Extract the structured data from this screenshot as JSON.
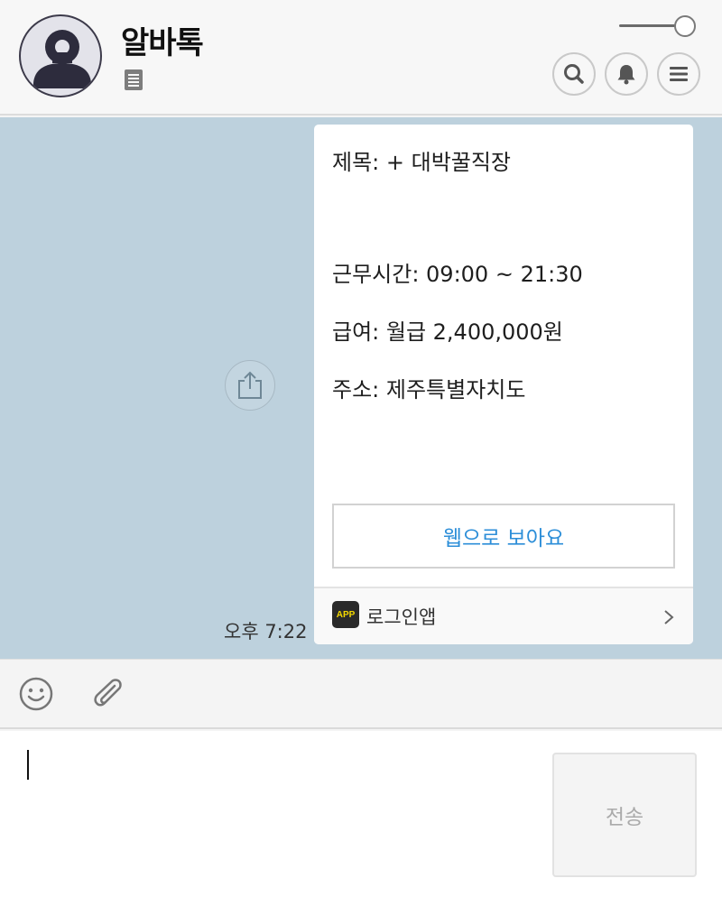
{
  "header": {
    "title": "알바톡"
  },
  "message": {
    "title_line": "제목:  + 대박꿀직장",
    "hours_line": "근무시간: 09:00 ~ 21:30",
    "pay_line": "급여: 월급 2,400,000원",
    "address_line": "주소: 제주특별자치도",
    "web_button_label": "웹으로 보아요",
    "app_badge": "APP",
    "app_label": "로그인앱",
    "time": "오후 7:22"
  },
  "composer": {
    "send_label": "전송",
    "value": ""
  },
  "colors": {
    "chat_background": "#bdd1dd",
    "link_blue": "#2c8ed8",
    "app_badge_yellow": "#f4d900"
  },
  "icons": {
    "profile": "person-icon",
    "note": "notepad-icon",
    "search": "search-icon",
    "bell": "bell-icon",
    "menu": "hamburger-menu-icon",
    "share": "share-icon",
    "chevron": "chevron-right-icon",
    "emoji": "smiley-icon",
    "attach": "paperclip-icon"
  }
}
